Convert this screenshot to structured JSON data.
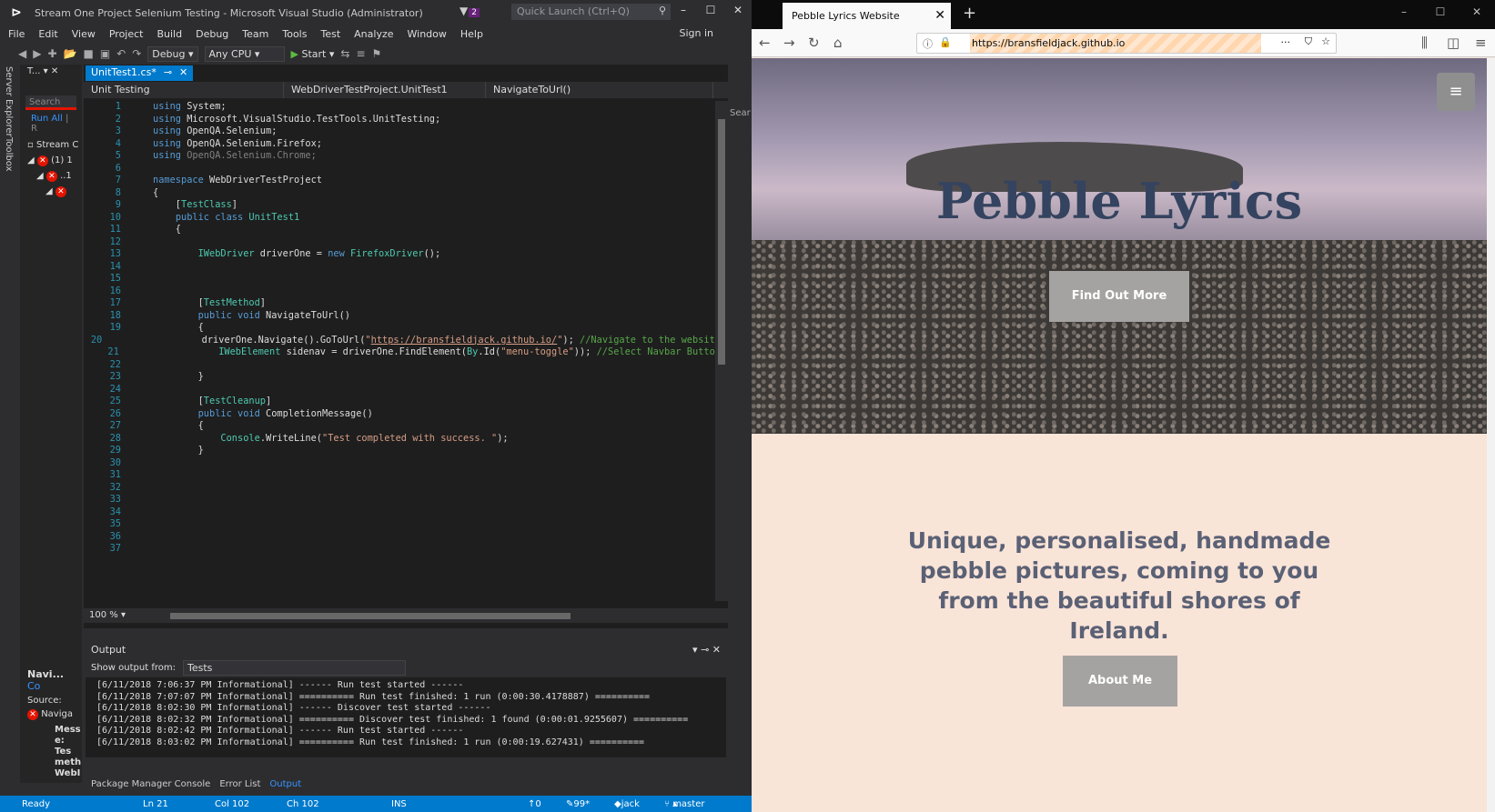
{
  "vs": {
    "title": "Stream One Project Selenium Testing - Microsoft Visual Studio  (Administrator)",
    "notif_count": "2",
    "quick_launch": "Quick Launch (Ctrl+Q)",
    "menu": [
      "File",
      "Edit",
      "View",
      "Project",
      "Build",
      "Debug",
      "Team",
      "Tools",
      "Test",
      "Analyze",
      "Window",
      "Help"
    ],
    "sign_in": "Sign in",
    "config": "Debug",
    "platform": "Any CPU",
    "start": "Start",
    "side_tabs": [
      "Server Explorer",
      "Toolbox"
    ],
    "explorer": {
      "header": "T...",
      "search": "Search",
      "run_all": "Run All",
      "run_sep": "| R",
      "items": [
        "Stream C",
        "(1) 1",
        "..1",
        ""
      ]
    },
    "doc_tab": "UnitTest1.cs*",
    "nav": {
      "scope": "Unit Testing",
      "class": "WebDriverTestProject.UnitTest1",
      "member": "NavigateToUrl()"
    },
    "right_search": "Sear",
    "zoom": "100 %",
    "output": {
      "title": "Output",
      "show_from_label": "Show output from:",
      "show_from_value": "Tests",
      "lines": [
        "[6/11/2018 7:06:37 PM Informational] ------ Run test started ------",
        "[6/11/2018 7:07:07 PM Informational] ========== Run test finished: 1 run (0:00:30.4178887) ==========",
        "[6/11/2018 8:02:30 PM Informational] ------ Discover test started ------",
        "[6/11/2018 8:02:32 PM Informational] ========== Discover test finished: 1 found (0:00:01.9255607) ==========",
        "[6/11/2018 8:02:42 PM Informational] ------ Run test started ------",
        "[6/11/2018 8:03:02 PM Informational] ========== Run test finished: 1 run (0:00:19.627431) =========="
      ]
    },
    "nav2": {
      "title": "Navi...",
      "link": "Co",
      "source": "Source:",
      "item": "Naviga",
      "details": [
        "Mess",
        "e: Tes",
        "meth",
        "WebI"
      ]
    },
    "bottom_tabs": [
      "Package Manager Console",
      "Error List",
      "Output"
    ],
    "status": {
      "ready": "Ready",
      "ln": "Ln 21",
      "col": "Col 102",
      "ch": "Ch 102",
      "ins": "INS",
      "up": "0",
      "pencil": "99*",
      "user": "jack",
      "branch": "master"
    }
  },
  "ff": {
    "tab_title": "Pebble Lyrics Website",
    "url": "https://bransfieldjack.github.io",
    "hero_title": "Pebble Lyrics",
    "find_out": "Find Out More",
    "tagline": "Unique, personalised, handmade pebble pictures, coming to you from the beautiful shores of Ireland.",
    "about": "About Me"
  }
}
